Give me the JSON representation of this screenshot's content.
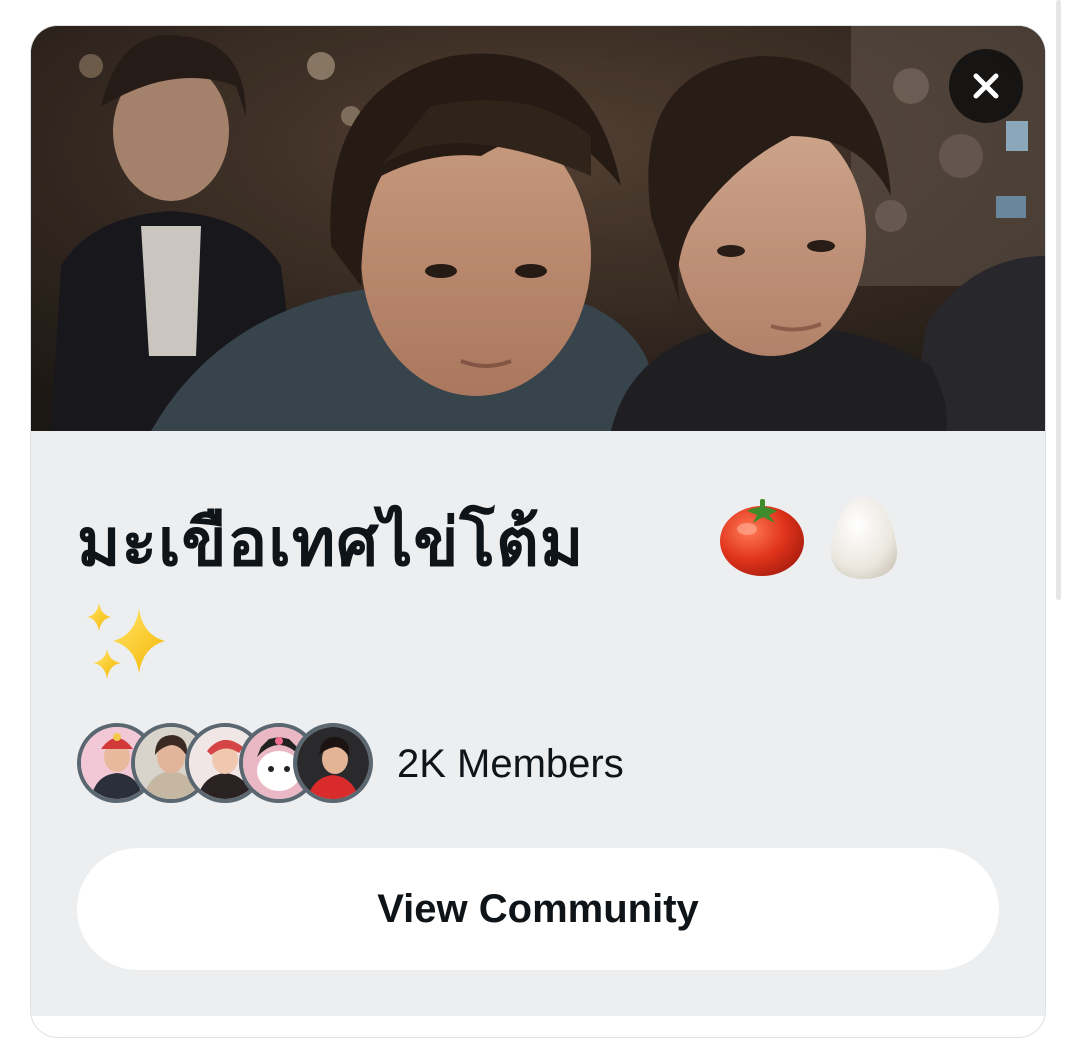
{
  "community": {
    "name": "มะเขือเทศไข่โต้ม",
    "name_emojis": [
      "tomato",
      "egg",
      "sparkles"
    ],
    "members_label": "2K Members",
    "view_button_label": "View Community"
  },
  "icons": {
    "close": "close-icon"
  },
  "colors": {
    "card_info_bg": "#eceef0",
    "title_text": "#0f1419",
    "close_button_bg": "#0f0f0f",
    "avatar_border": "#5a6670"
  }
}
